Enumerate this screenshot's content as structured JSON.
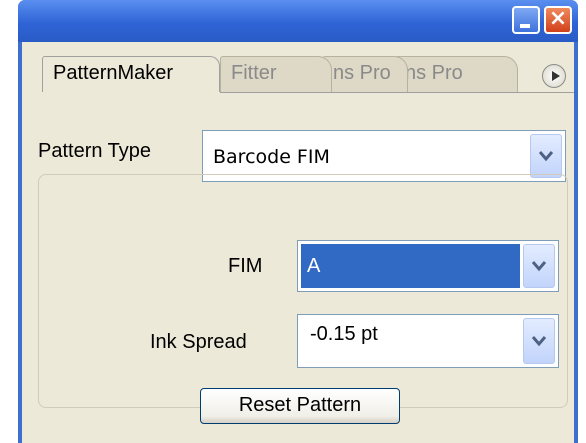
{
  "titlebar": {
    "minimize_icon": "minimize-icon",
    "close_icon": "close-icon"
  },
  "tabs": [
    {
      "label": "PatternMaker",
      "active": true
    },
    {
      "label": "Fitter",
      "active": false
    },
    {
      "label": "ns Pro",
      "active": false
    },
    {
      "label": "ns Pro",
      "active": false
    }
  ],
  "panel_menu_icon": "panel-menu-icon",
  "pattern_type": {
    "label": "Pattern Type",
    "value": "Barcode FIM"
  },
  "fim": {
    "label": "FIM",
    "value": "A"
  },
  "ink_spread": {
    "label": "Ink Spread",
    "value": "-0.15 pt"
  },
  "reset_button": {
    "label": "Reset Pattern"
  },
  "colors": {
    "titlebar": "#2f64d6",
    "panel_bg": "#ece9d8",
    "selection": "#316ac5",
    "close_button": "#d1401b"
  }
}
